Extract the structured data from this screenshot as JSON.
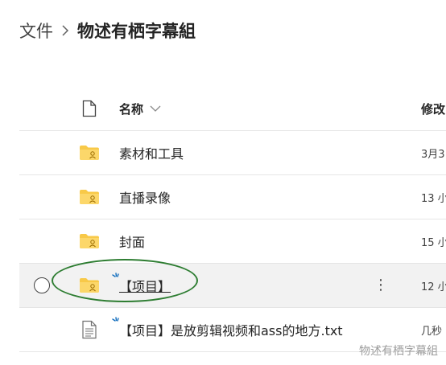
{
  "breadcrumb": {
    "root": "文件",
    "current": "物述有栖字幕組"
  },
  "columns": {
    "name": "名称",
    "modified": "修改"
  },
  "rows": [
    {
      "name": "素材和工具",
      "modified": "3月3",
      "icon": "folder-icon"
    },
    {
      "name": "直播录像",
      "modified": "13 小",
      "icon": "folder-icon"
    },
    {
      "name": "封面",
      "modified": "15 小",
      "icon": "folder-icon"
    },
    {
      "name": "【项目】",
      "modified": "12 小",
      "icon": "folder-icon",
      "selected": true,
      "new": true
    },
    {
      "name": "【项目】是放剪辑视频和ass的地方.txt",
      "modified": "几秒",
      "icon": "text-file-icon",
      "new": true
    }
  ],
  "more_label": "⋮",
  "watermark": "物述有栖字幕組",
  "colors": {
    "folder": "#f8c948",
    "annotation": "#2e7d32",
    "new_marker": "#0f6cbd"
  }
}
